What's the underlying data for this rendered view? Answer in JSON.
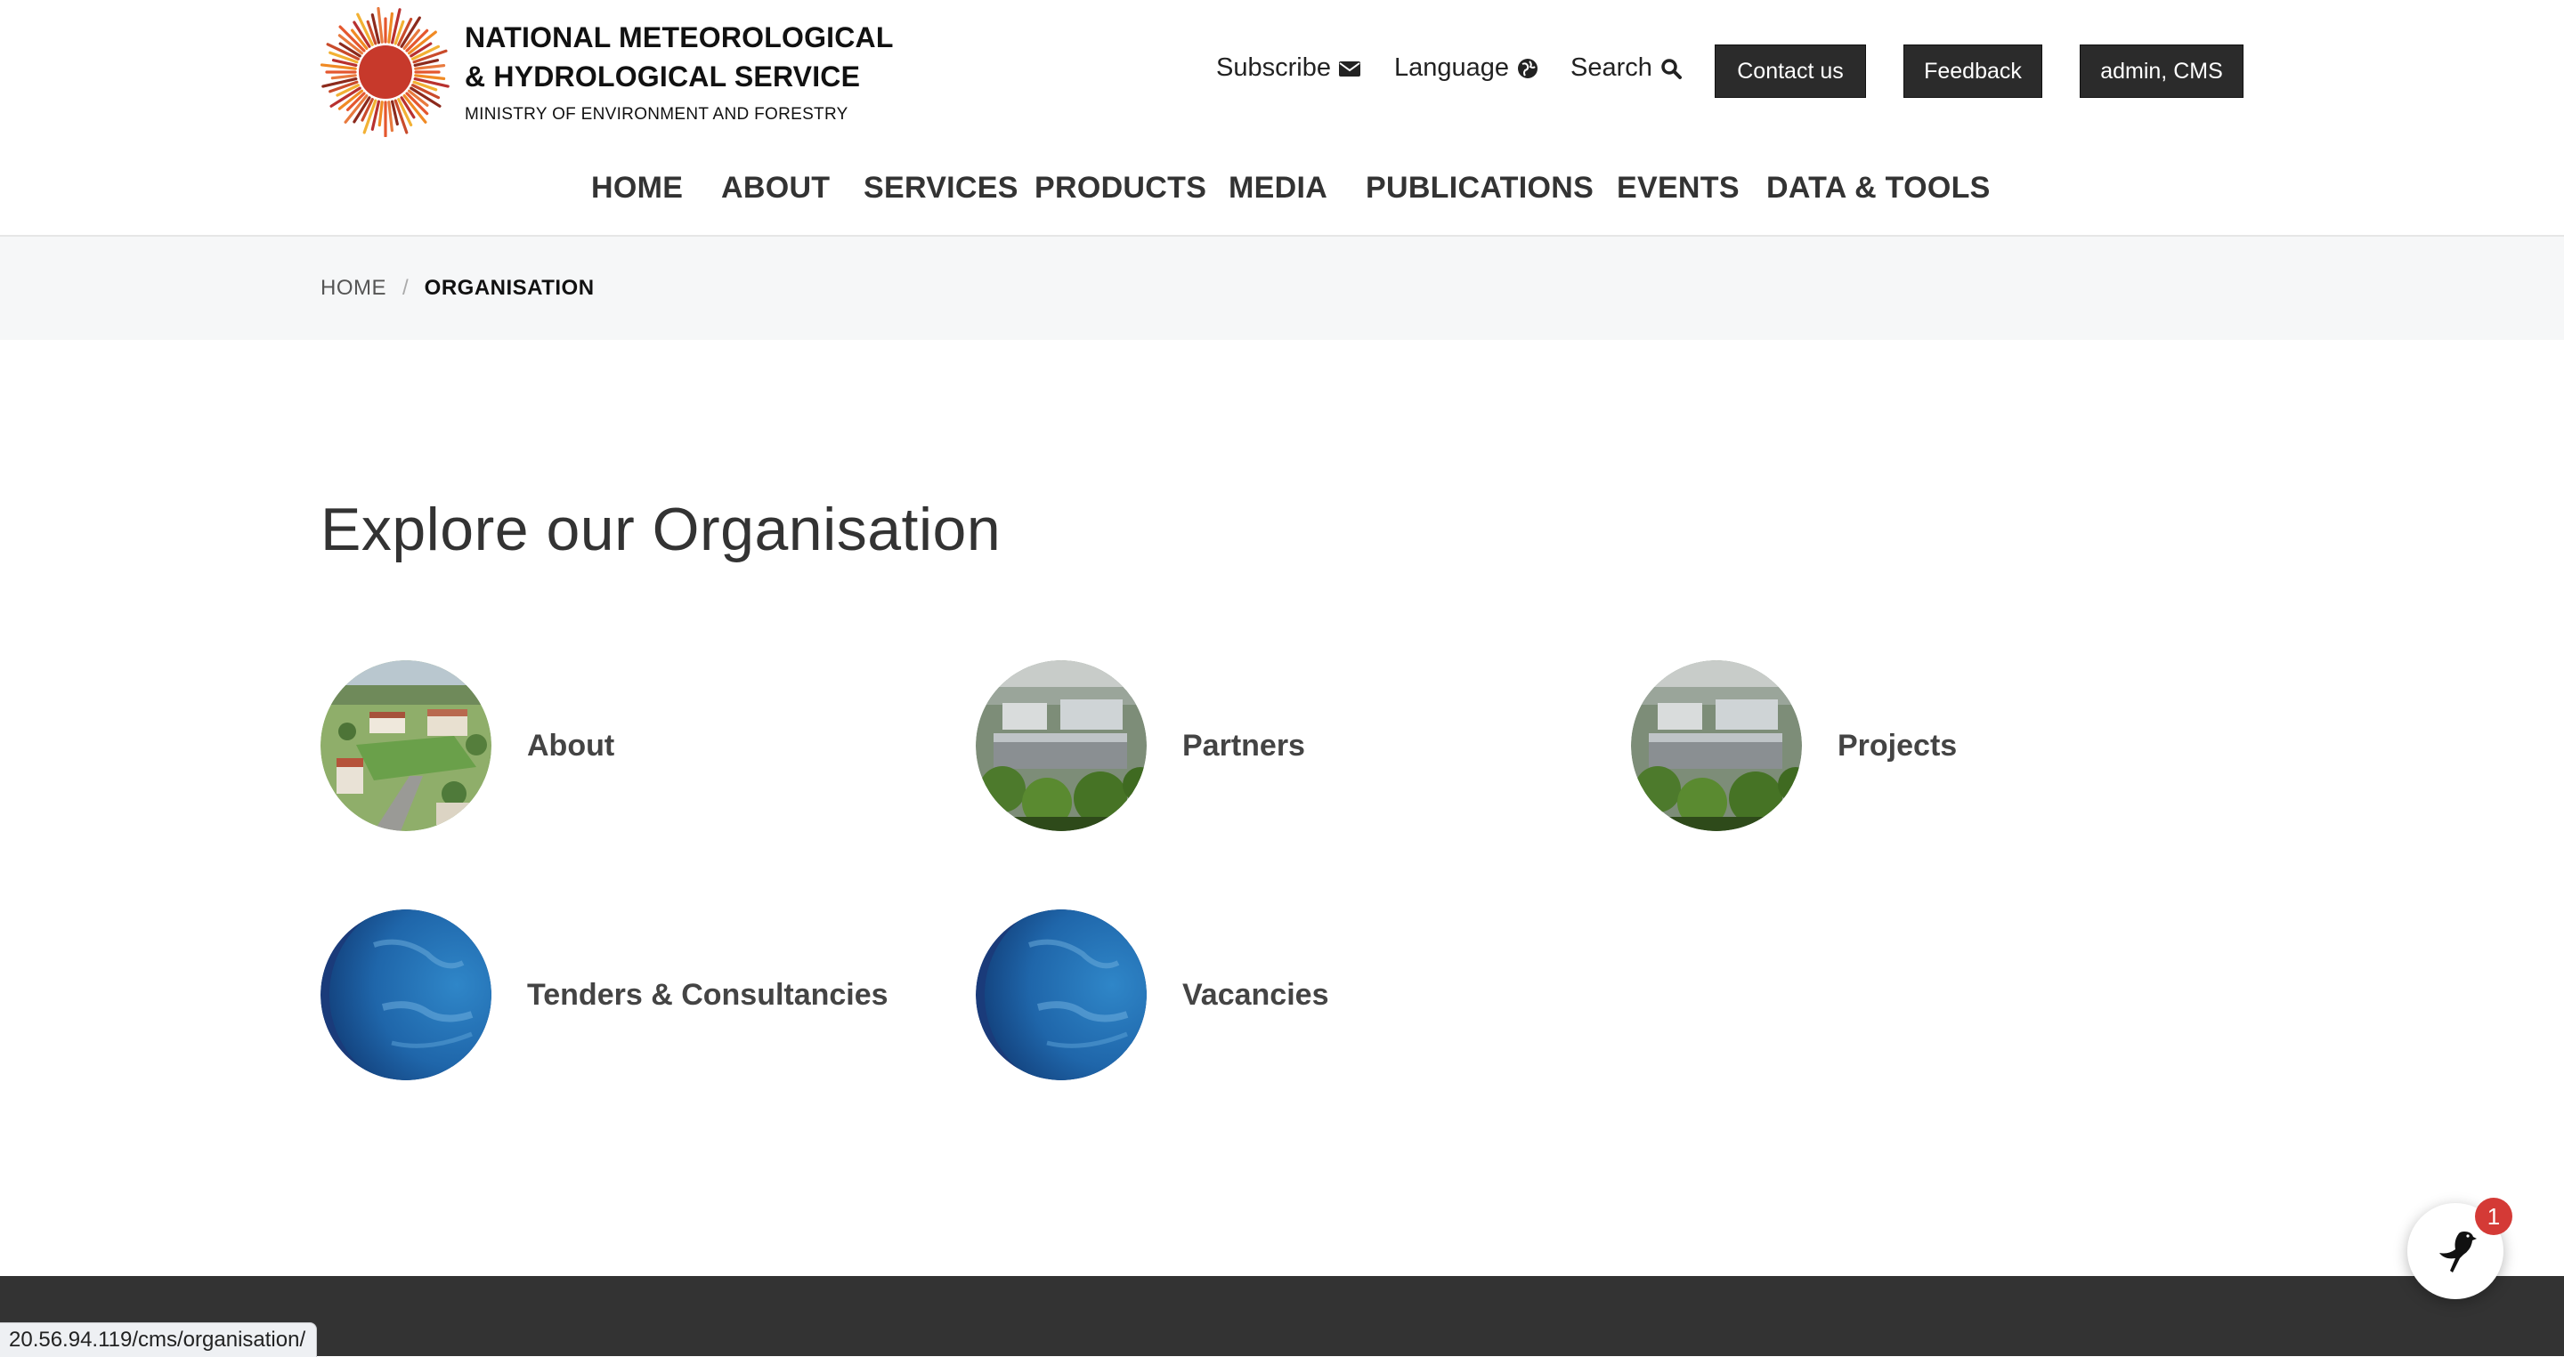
{
  "brand": {
    "line1": "NATIONAL METEOROLOGICAL",
    "line2": "& HYDROLOGICAL SERVICE",
    "line3": "MINISTRY OF ENVIRONMENT AND FORESTRY"
  },
  "utility": {
    "subscribe": "Subscribe",
    "language": "Language",
    "search": "Search",
    "contact": "Contact us",
    "feedback": "Feedback",
    "admin": "admin, CMS"
  },
  "nav": [
    "HOME",
    "ABOUT",
    "SERVICES",
    "PRODUCTS",
    "MEDIA",
    "PUBLICATIONS",
    "EVENTS",
    "DATA & TOOLS"
  ],
  "breadcrumb": {
    "home": "HOME",
    "separator": "/",
    "current": "ORGANISATION"
  },
  "page_title": "Explore our Organisation",
  "cards": [
    {
      "label": "About",
      "image": "campus-aerial"
    },
    {
      "label": "Partners",
      "image": "building-aerial"
    },
    {
      "label": "Projects",
      "image": "building-aerial"
    },
    {
      "label": "Tenders & Consultancies",
      "image": "earth-globe"
    },
    {
      "label": "Vacancies",
      "image": "earth-globe"
    }
  ],
  "fab": {
    "badge": "1"
  },
  "status_url": "20.56.94.119/cms/organisation/"
}
